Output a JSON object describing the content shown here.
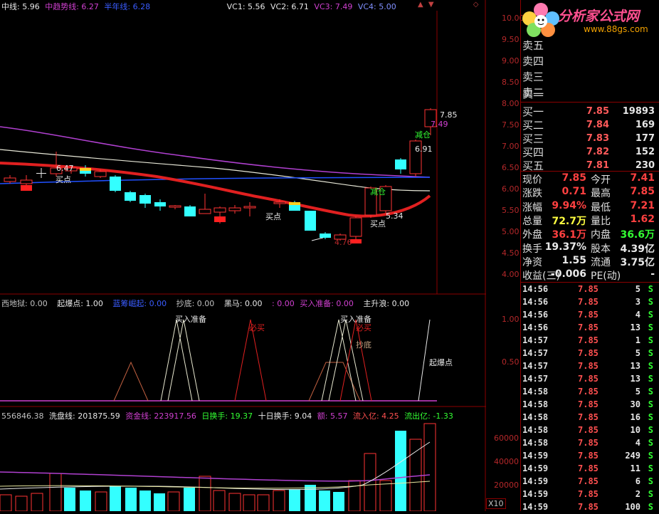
{
  "colors": {
    "up": "#ff3333",
    "down": "#33ffff",
    "bg": "#000000",
    "grid": "#8b0000",
    "ma_red": "#e02020",
    "ma_purple": "#b040d0",
    "ma_white": "#e8e8d8",
    "ma_blue": "#2050ff"
  },
  "top_header": [
    {
      "text": "中线: 5.96",
      "color": "#e8e8e8"
    },
    {
      "text": "中趋势线: 6.27",
      "color": "#d040d0"
    },
    {
      "text": "半年线: 6.28",
      "color": "#3a5cff"
    },
    {
      "text": "VC1: 5.56",
      "color": "#e8e8e8"
    },
    {
      "text": "VC2: 6.71",
      "color": "#e8e8e8"
    },
    {
      "text": "VC3: 7.49",
      "color": "#d040d0"
    },
    {
      "text": "VC4: 5.00",
      "color": "#8090ff"
    }
  ],
  "header_icons": [
    "▲",
    "▼",
    "◇"
  ],
  "price_axis": [
    "10.00",
    "9.50",
    "9.00",
    "8.50",
    "8.00",
    "7.50",
    "7.00",
    "6.50",
    "6.00",
    "5.50",
    "5.00",
    "4.50",
    "4.00"
  ],
  "price_annotations": {
    "buy1": "买点",
    "buy2": "买点",
    "buy3": "买点",
    "reduce1": "减仓",
    "reduce2": "减仓",
    "v647": "6.47",
    "v534": "5.34",
    "v691": "6.91",
    "v785": "7.85",
    "v749": "7.49",
    "v476": "4.76"
  },
  "mid_header": [
    {
      "text": "西地狱: 0.00",
      "color": "#c0c0c0"
    },
    {
      "text": "起爆点: 1.00",
      "color": "#e8e8e8"
    },
    {
      "text": "蓝筹崛起: 0.00",
      "color": "#3a5cff"
    },
    {
      "text": "抄底: 0.00",
      "color": "#c0c0c0"
    },
    {
      "text": "黑马: 0.00",
      "color": "#e8e8e8"
    },
    {
      "text": ": 0.00",
      "color": "#d040d0"
    },
    {
      "text": "买入准备: 0.00",
      "color": "#d040d0"
    },
    {
      "text": "主升浪: 0.00",
      "color": "#e8e8e8"
    }
  ],
  "mid_axis": [
    "1.00",
    "0.50"
  ],
  "mid_annotations": {
    "prep1": "买入准备",
    "prep2": "买入准备",
    "must1": "必买",
    "must2": "必买",
    "bottom": "抄底",
    "explode": "起爆点"
  },
  "bottom_header": [
    {
      "text": "556846.38",
      "color": "#c0c0c0"
    },
    {
      "text": "洗盘线: 201875.59",
      "color": "#e8e8e8"
    },
    {
      "text": "资金线: 223917.56",
      "color": "#d040d0"
    },
    {
      "text": "日换手: 19.37",
      "color": "#33ff33"
    },
    {
      "text": "十日换手: 9.04",
      "color": "#e8e8e8"
    },
    {
      "text": "额: 5.57",
      "color": "#d040d0"
    },
    {
      "text": "流入亿: 4.25",
      "color": "#ff5050"
    },
    {
      "text": "流出亿: -1.33",
      "color": "#33ff33"
    }
  ],
  "vol_axis": [
    "60000",
    "40000",
    "20000"
  ],
  "vol_unit": "X10",
  "logo": {
    "title": "分析家公式网",
    "url": "www.88gs.com"
  },
  "sell_labels": [
    "卖五",
    "卖四",
    "卖三",
    "卖二",
    "卖一"
  ],
  "buy_quotes": [
    {
      "label": "买一",
      "price": "7.85",
      "vol": "19893"
    },
    {
      "label": "买二",
      "price": "7.84",
      "vol": "169"
    },
    {
      "label": "买三",
      "price": "7.83",
      "vol": "177"
    },
    {
      "label": "买四",
      "price": "7.82",
      "vol": "152"
    },
    {
      "label": "买五",
      "price": "7.81",
      "vol": "230"
    }
  ],
  "stats": [
    {
      "l1": "现价",
      "v1": "7.85",
      "c1": "#ff4040",
      "l2": "今开",
      "v2": "7.41",
      "c2": "#ff4040"
    },
    {
      "l1": "涨跌",
      "v1": "0.71",
      "c1": "#ff4040",
      "l2": "最高",
      "v2": "7.85",
      "c2": "#ff4040"
    },
    {
      "l1": "涨幅",
      "v1": "9.94%",
      "c1": "#ff4040",
      "l2": "最低",
      "v2": "7.21",
      "c2": "#ff4040"
    },
    {
      "l1": "总量",
      "v1": "72.7万",
      "c1": "#ffff40",
      "l2": "量比",
      "v2": "1.62",
      "c2": "#ff4040"
    },
    {
      "l1": "外盘",
      "v1": "36.1万",
      "c1": "#ff4040",
      "l2": "内盘",
      "v2": "36.6万",
      "c2": "#33ff33"
    },
    {
      "l1": "换手",
      "v1": "19.37%",
      "c1": "#e8e8e8",
      "l2": "股本",
      "v2": "4.39亿",
      "c2": "#e8e8e8"
    },
    {
      "l1": "净资",
      "v1": "1.55",
      "c1": "#e8e8e8",
      "l2": "流通",
      "v2": "3.75亿",
      "c2": "#e8e8e8"
    },
    {
      "l1": "收益(三)",
      "v1": "-0.006",
      "c1": "#e8e8e8",
      "l2": "PE(动)",
      "v2": "-",
      "c2": "#e8e8e8"
    }
  ],
  "ticks": [
    {
      "t": "14:56",
      "p": "7.85",
      "v": "5",
      "s": "S"
    },
    {
      "t": "14:56",
      "p": "7.85",
      "v": "3",
      "s": "S"
    },
    {
      "t": "14:56",
      "p": "7.85",
      "v": "4",
      "s": "S"
    },
    {
      "t": "14:56",
      "p": "7.85",
      "v": "13",
      "s": "S"
    },
    {
      "t": "14:57",
      "p": "7.85",
      "v": "1",
      "s": "S"
    },
    {
      "t": "14:57",
      "p": "7.85",
      "v": "5",
      "s": "S"
    },
    {
      "t": "14:57",
      "p": "7.85",
      "v": "13",
      "s": "S"
    },
    {
      "t": "14:57",
      "p": "7.85",
      "v": "13",
      "s": "S"
    },
    {
      "t": "14:58",
      "p": "7.85",
      "v": "5",
      "s": "S"
    },
    {
      "t": "14:58",
      "p": "7.85",
      "v": "30",
      "s": "S"
    },
    {
      "t": "14:58",
      "p": "7.85",
      "v": "16",
      "s": "S"
    },
    {
      "t": "14:58",
      "p": "7.85",
      "v": "10",
      "s": "S"
    },
    {
      "t": "14:58",
      "p": "7.85",
      "v": "4",
      "s": "S"
    },
    {
      "t": "14:59",
      "p": "7.85",
      "v": "249",
      "s": "S"
    },
    {
      "t": "14:59",
      "p": "7.85",
      "v": "11",
      "s": "S"
    },
    {
      "t": "14:59",
      "p": "7.85",
      "v": "6",
      "s": "S"
    },
    {
      "t": "14:59",
      "p": "7.85",
      "v": "2",
      "s": "S"
    },
    {
      "t": "14:59",
      "p": "7.85",
      "v": "100",
      "s": "S"
    }
  ]
}
